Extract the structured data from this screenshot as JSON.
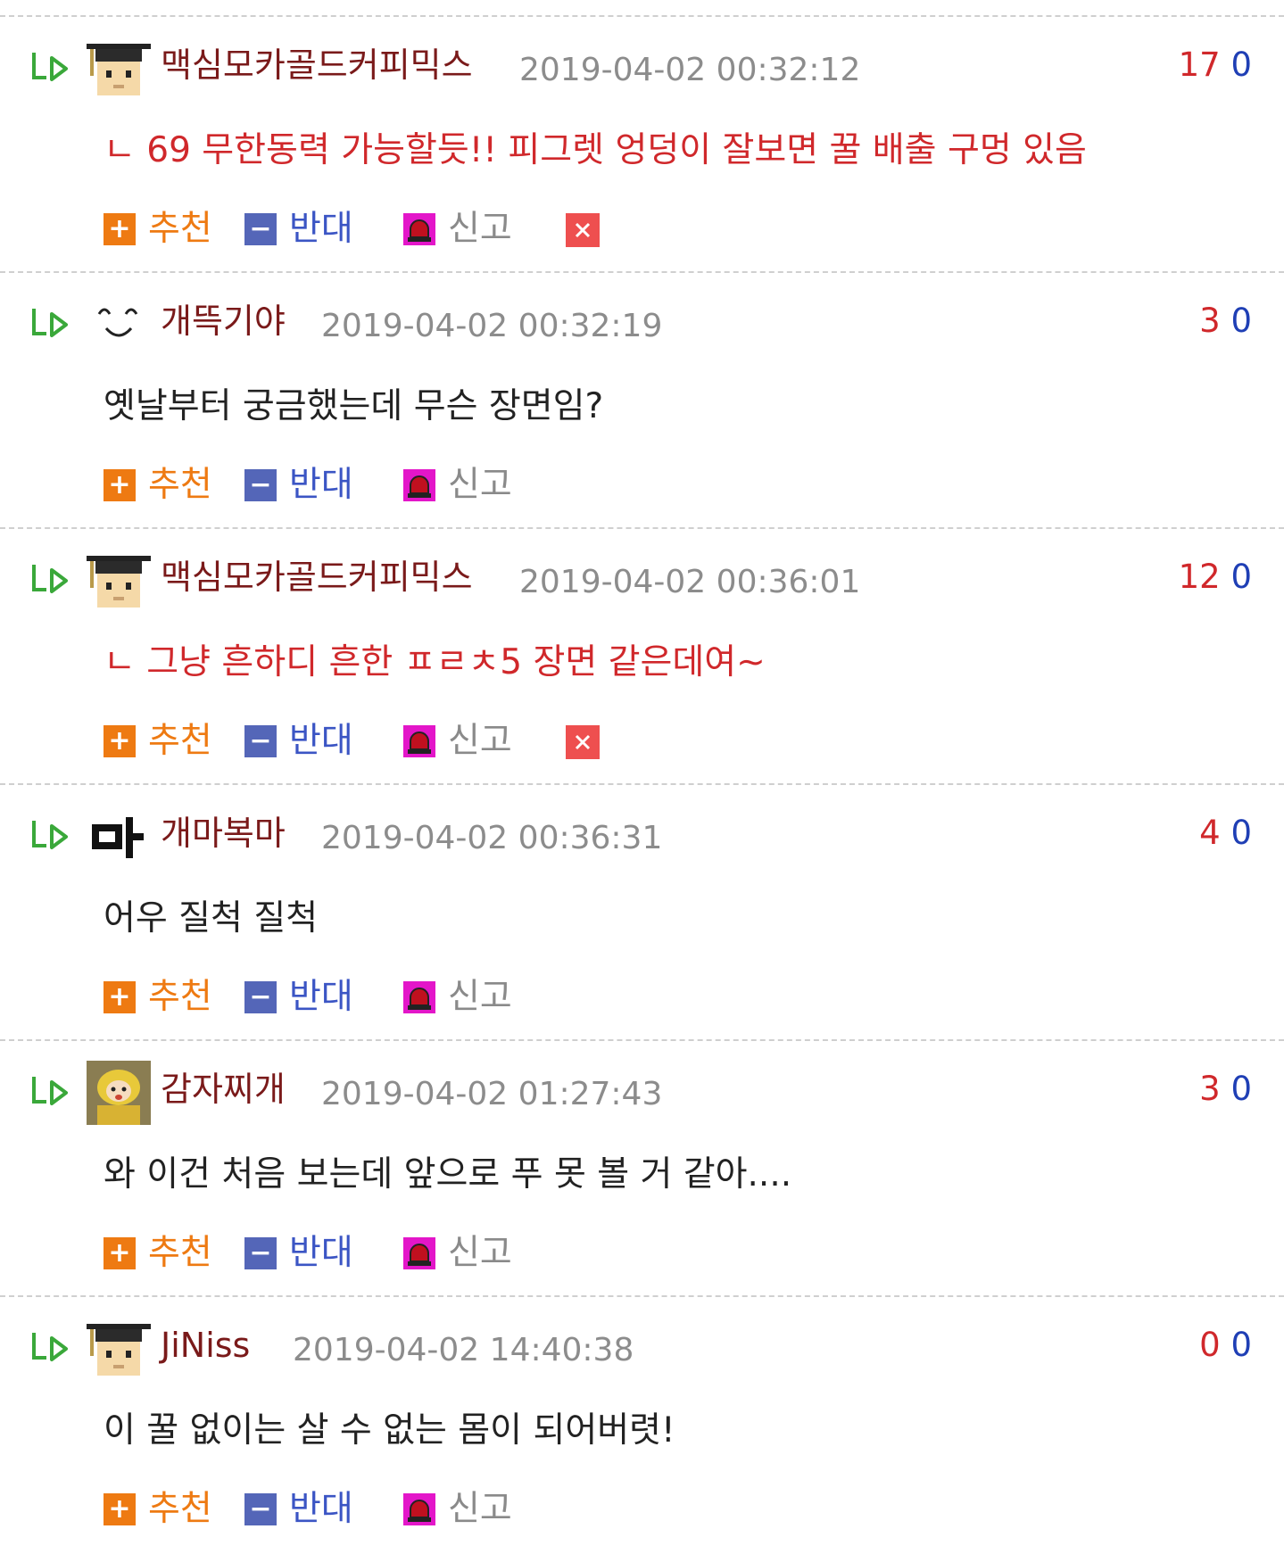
{
  "comments": [
    {
      "author": "맥심모카골드커피믹스",
      "date": "2019-04-02 00:32:12",
      "up": "17",
      "down": "0",
      "text": "ㄴ 69 무한동력 가능할듯!! 피그렛 엉덩이 잘보면 꿀 배출 구멍 있음",
      "text_red": true,
      "avatar": "graduate-avatar",
      "deletable": true
    },
    {
      "author": "개뜩기야",
      "date": "2019-04-02 00:32:19",
      "up": "3",
      "down": "0",
      "text": "옛날부터 궁금했는데 무슨 장면임?",
      "text_red": false,
      "avatar": "face-emoticon-avatar",
      "deletable": false
    },
    {
      "author": "맥심모카골드커피믹스",
      "date": "2019-04-02 00:36:01",
      "up": "12",
      "down": "0",
      "text": "ㄴ 그냥 흔하디 흔한 ㅍㄹㅊ5 장면 같은데여~",
      "text_red": true,
      "avatar": "graduate-avatar",
      "deletable": true
    },
    {
      "author": "개마복마",
      "date": "2019-04-02 00:36:31",
      "up": "4",
      "down": "0",
      "text": "어우 질척 질척",
      "text_red": false,
      "avatar": "ma-glyph-avatar",
      "deletable": false
    },
    {
      "author": "감자찌개",
      "date": "2019-04-02 01:27:43",
      "up": "3",
      "down": "0",
      "text": "와 이건 처음 보는데 앞으로 푸 못 볼 거 같아....",
      "text_red": false,
      "avatar": "cartoon-photo-avatar",
      "deletable": false
    },
    {
      "author": "JiNiss",
      "date": "2019-04-02 14:40:38",
      "up": "0",
      "down": "0",
      "text": "이 꿀 없이는 살 수 없는 몸이 되어버렷!",
      "text_red": false,
      "avatar": "graduate-avatar",
      "deletable": false
    }
  ],
  "labels": {
    "recommend": "추천",
    "oppose": "반대",
    "report": "신고"
  },
  "colors": {
    "author": "#7a1a1a",
    "score_up": "#d0282b",
    "score_down": "#1f3fb5",
    "recommend": "#ee7a12",
    "oppose": "#5466b8",
    "report_icon": "#e316c9",
    "delete": "#ee4f4f",
    "reply_arrow": "#3aa83a"
  }
}
